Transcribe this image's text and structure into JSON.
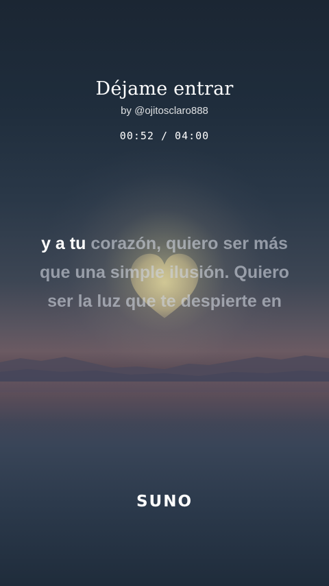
{
  "song": {
    "title": "Déjame entrar",
    "artist": "by @ojitosclaro888",
    "time": "00:52 / 04:00",
    "position_seconds": 52,
    "duration_seconds": 240
  },
  "lyrics": {
    "line1_sung": "y a tu",
    "line1_rest": " corazón, quiero ser más",
    "line2": "que una simple ilusión. Quiero",
    "line3": "ser la luz que te despierte en"
  },
  "brand": {
    "logo_text": "SUNO"
  },
  "colors": {
    "sung_text": "#ffffff",
    "unsung_text": "#cdd2dc",
    "background_top": "#1b2633",
    "background_bottom": "#1f2c3b"
  },
  "icons": {
    "heart": "heart-icon"
  }
}
